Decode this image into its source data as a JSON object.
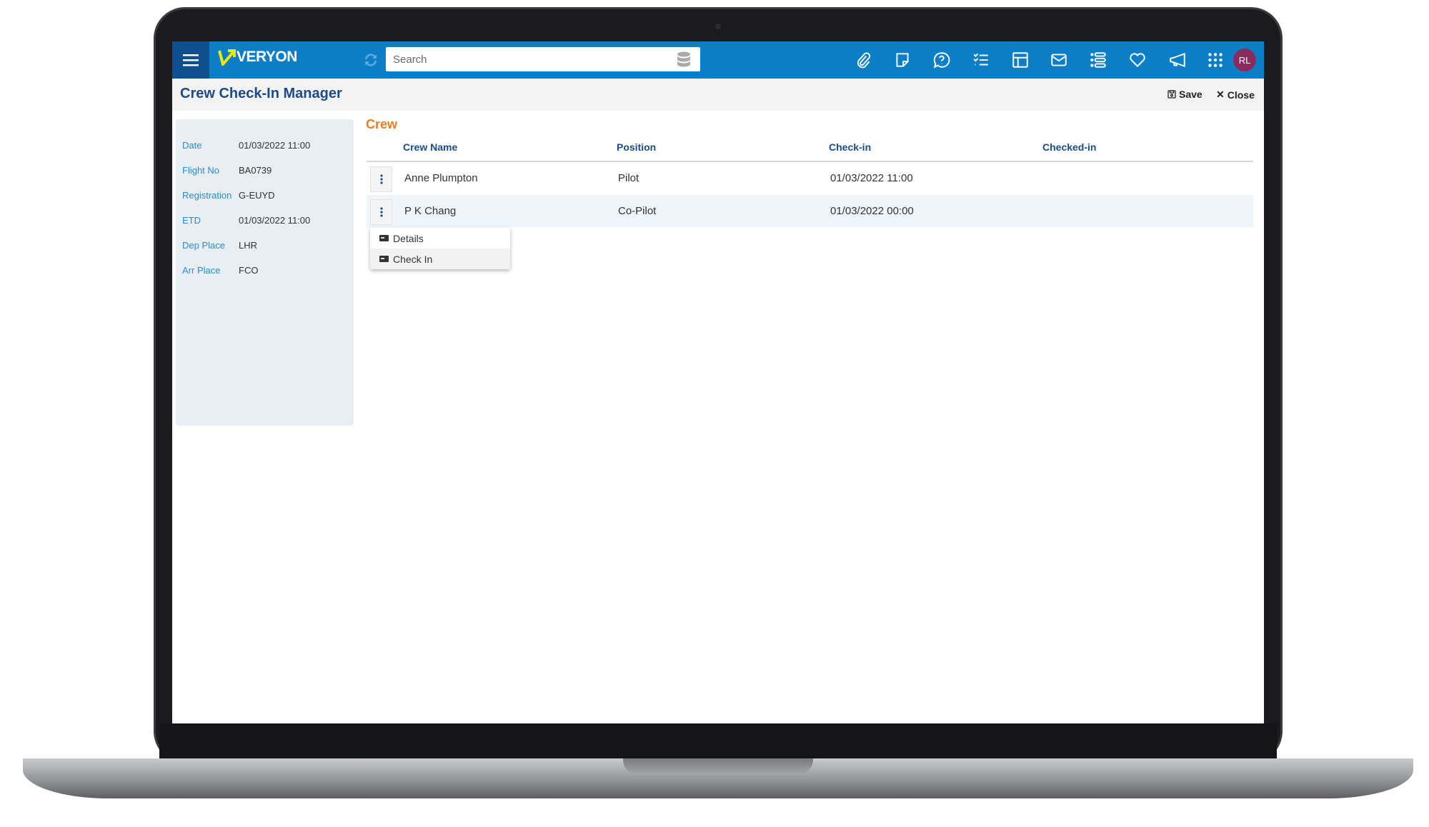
{
  "topbar": {
    "brand": "VERYON",
    "search_placeholder": "Search",
    "icons": [
      "paperclip-icon",
      "note-icon",
      "help-chat-icon",
      "checklist-icon",
      "layout-icon",
      "mail-icon",
      "list-icon",
      "heart-icon",
      "megaphone-icon",
      "apps-grid-icon"
    ],
    "avatar_initials": "RL",
    "colors": {
      "bar": "#0a7fc7",
      "menu_block": "#0e4f8f",
      "logo_mark": "#f5e800",
      "avatar": "#8a2a5e"
    }
  },
  "page": {
    "title": "Crew Check-In Manager",
    "save_label": "Save",
    "close_label": "Close"
  },
  "flight": [
    {
      "label": "Date",
      "value": "01/03/2022 11:00"
    },
    {
      "label": "Flight No",
      "value": "BA0739"
    },
    {
      "label": "Registration",
      "value": "G-EUYD"
    },
    {
      "label": "ETD",
      "value": "01/03/2022 11:00"
    },
    {
      "label": "Dep Place",
      "value": "LHR"
    },
    {
      "label": "Arr Place",
      "value": "FCO"
    }
  ],
  "crew": {
    "heading": "Crew",
    "columns": [
      "Crew Name",
      "Position",
      "Check-in",
      "Checked-in"
    ],
    "rows": [
      {
        "name": "Anne Plumpton",
        "position": "Pilot",
        "checkin": "01/03/2022 11:00",
        "checked_in": ""
      },
      {
        "name": "P K Chang",
        "position": "Co-Pilot",
        "checkin": "01/03/2022 00:00",
        "checked_in": ""
      }
    ],
    "context_menu": [
      "Details",
      "Check In"
    ]
  }
}
